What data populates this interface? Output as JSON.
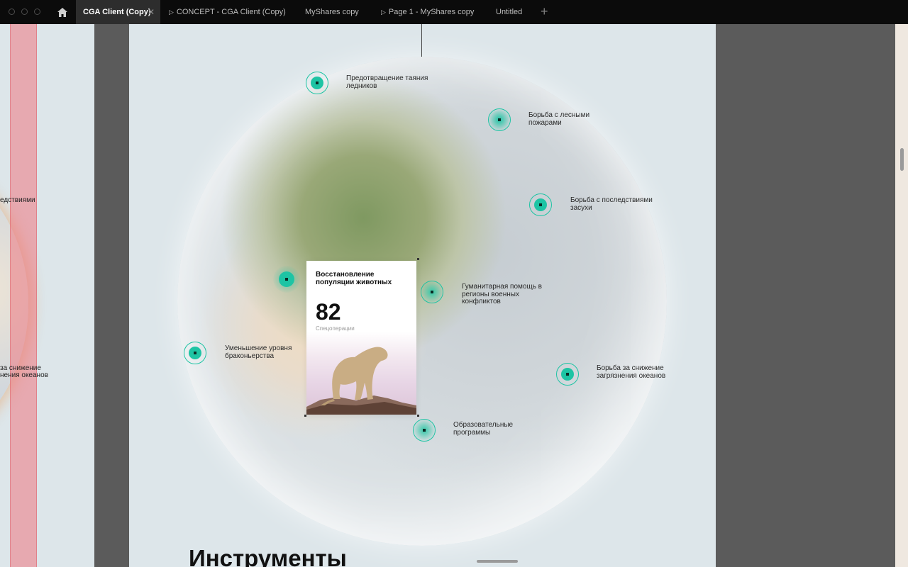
{
  "tabs": [
    {
      "label": "CGA Client (Copy)",
      "active": true,
      "icon": "close-icon"
    },
    {
      "label": "CONCEPT - CGA Client (Copy)",
      "icon": "play-icon"
    },
    {
      "label": "MyShares copy"
    },
    {
      "label": "Page 1 - MyShares copy",
      "icon": "play-icon"
    },
    {
      "label": "Untitled"
    }
  ],
  "left_frame": {
    "label_1": "едствиями",
    "label_2a": "за снижение",
    "label_2b": "нения океанов"
  },
  "main": {
    "markers": [
      {
        "l1": "Предотвращение таяния",
        "l2": "ледников"
      },
      {
        "l1": "Борьба с лесными",
        "l2": "пожарами"
      },
      {
        "l1": "Борьба с последствиями",
        "l2": "засухи"
      },
      {
        "l1": "Гуманитарная помощь в",
        "l2": "регионы военных",
        "l3": "конфликтов"
      },
      {
        "l1": "Уменьшение уровня",
        "l2": "браконьерства"
      },
      {
        "l1": "Борьба за снижение",
        "l2": "загрязнения океанов"
      },
      {
        "l1": "Образовательные",
        "l2": "программы"
      }
    ],
    "card": {
      "title_1": "Восстановление",
      "title_2": "популяции животных",
      "number": "82",
      "subtitle": "Спецоперации"
    },
    "heading": "Инструменты"
  },
  "colors": {
    "accent": "#1ec4a4",
    "frame_bg": "#dde6ea",
    "canvas_bg": "#5b5b5b",
    "tabbar_bg": "#0b0b0b"
  }
}
